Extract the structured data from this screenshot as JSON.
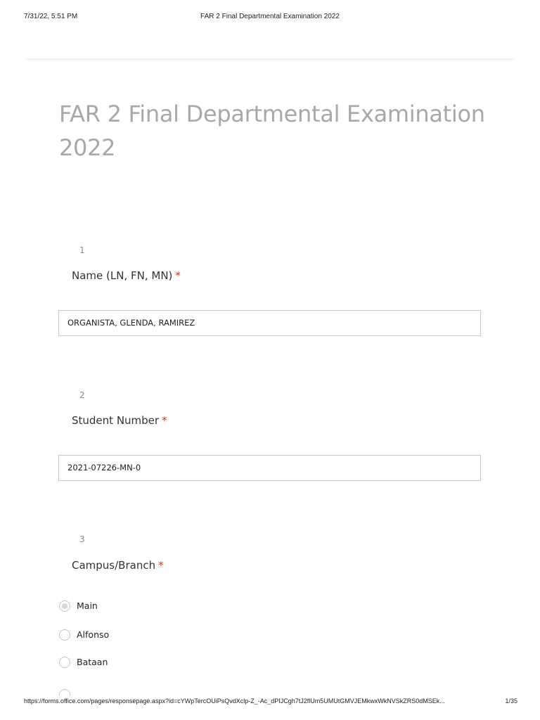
{
  "print_header": {
    "date": "7/31/22, 5:51 PM",
    "title": "FAR 2 Final Departmental Examination 2022"
  },
  "form": {
    "title": "FAR 2 Final Departmental Examination 2022",
    "required_marker": "*",
    "questions": [
      {
        "number": "1",
        "label": "Name (LN, FN, MN)",
        "answer": "ORGANISTA, GLENDA, RAMIREZ"
      },
      {
        "number": "2",
        "label": "Student Number",
        "answer": "2021-07226-MN-0"
      },
      {
        "number": "3",
        "label": "Campus/Branch",
        "options": [
          "Main",
          "Alfonso",
          "Bataan"
        ],
        "selected": "Main"
      }
    ]
  },
  "print_footer": {
    "url": "https://forms.office.com/pages/responsepage.aspx?id=cYWpTercOUiPsQvdXclp-Z_-Ac_dPIJCgh7tJ2flUm5UMUtGMVJEMkwxWkNVSkZRS0dMSEk...",
    "page": "1/35"
  },
  "colors": {
    "required_star": "#c43e1c",
    "title_gray": "#a8a8a8",
    "border": "#c8c8c8"
  }
}
